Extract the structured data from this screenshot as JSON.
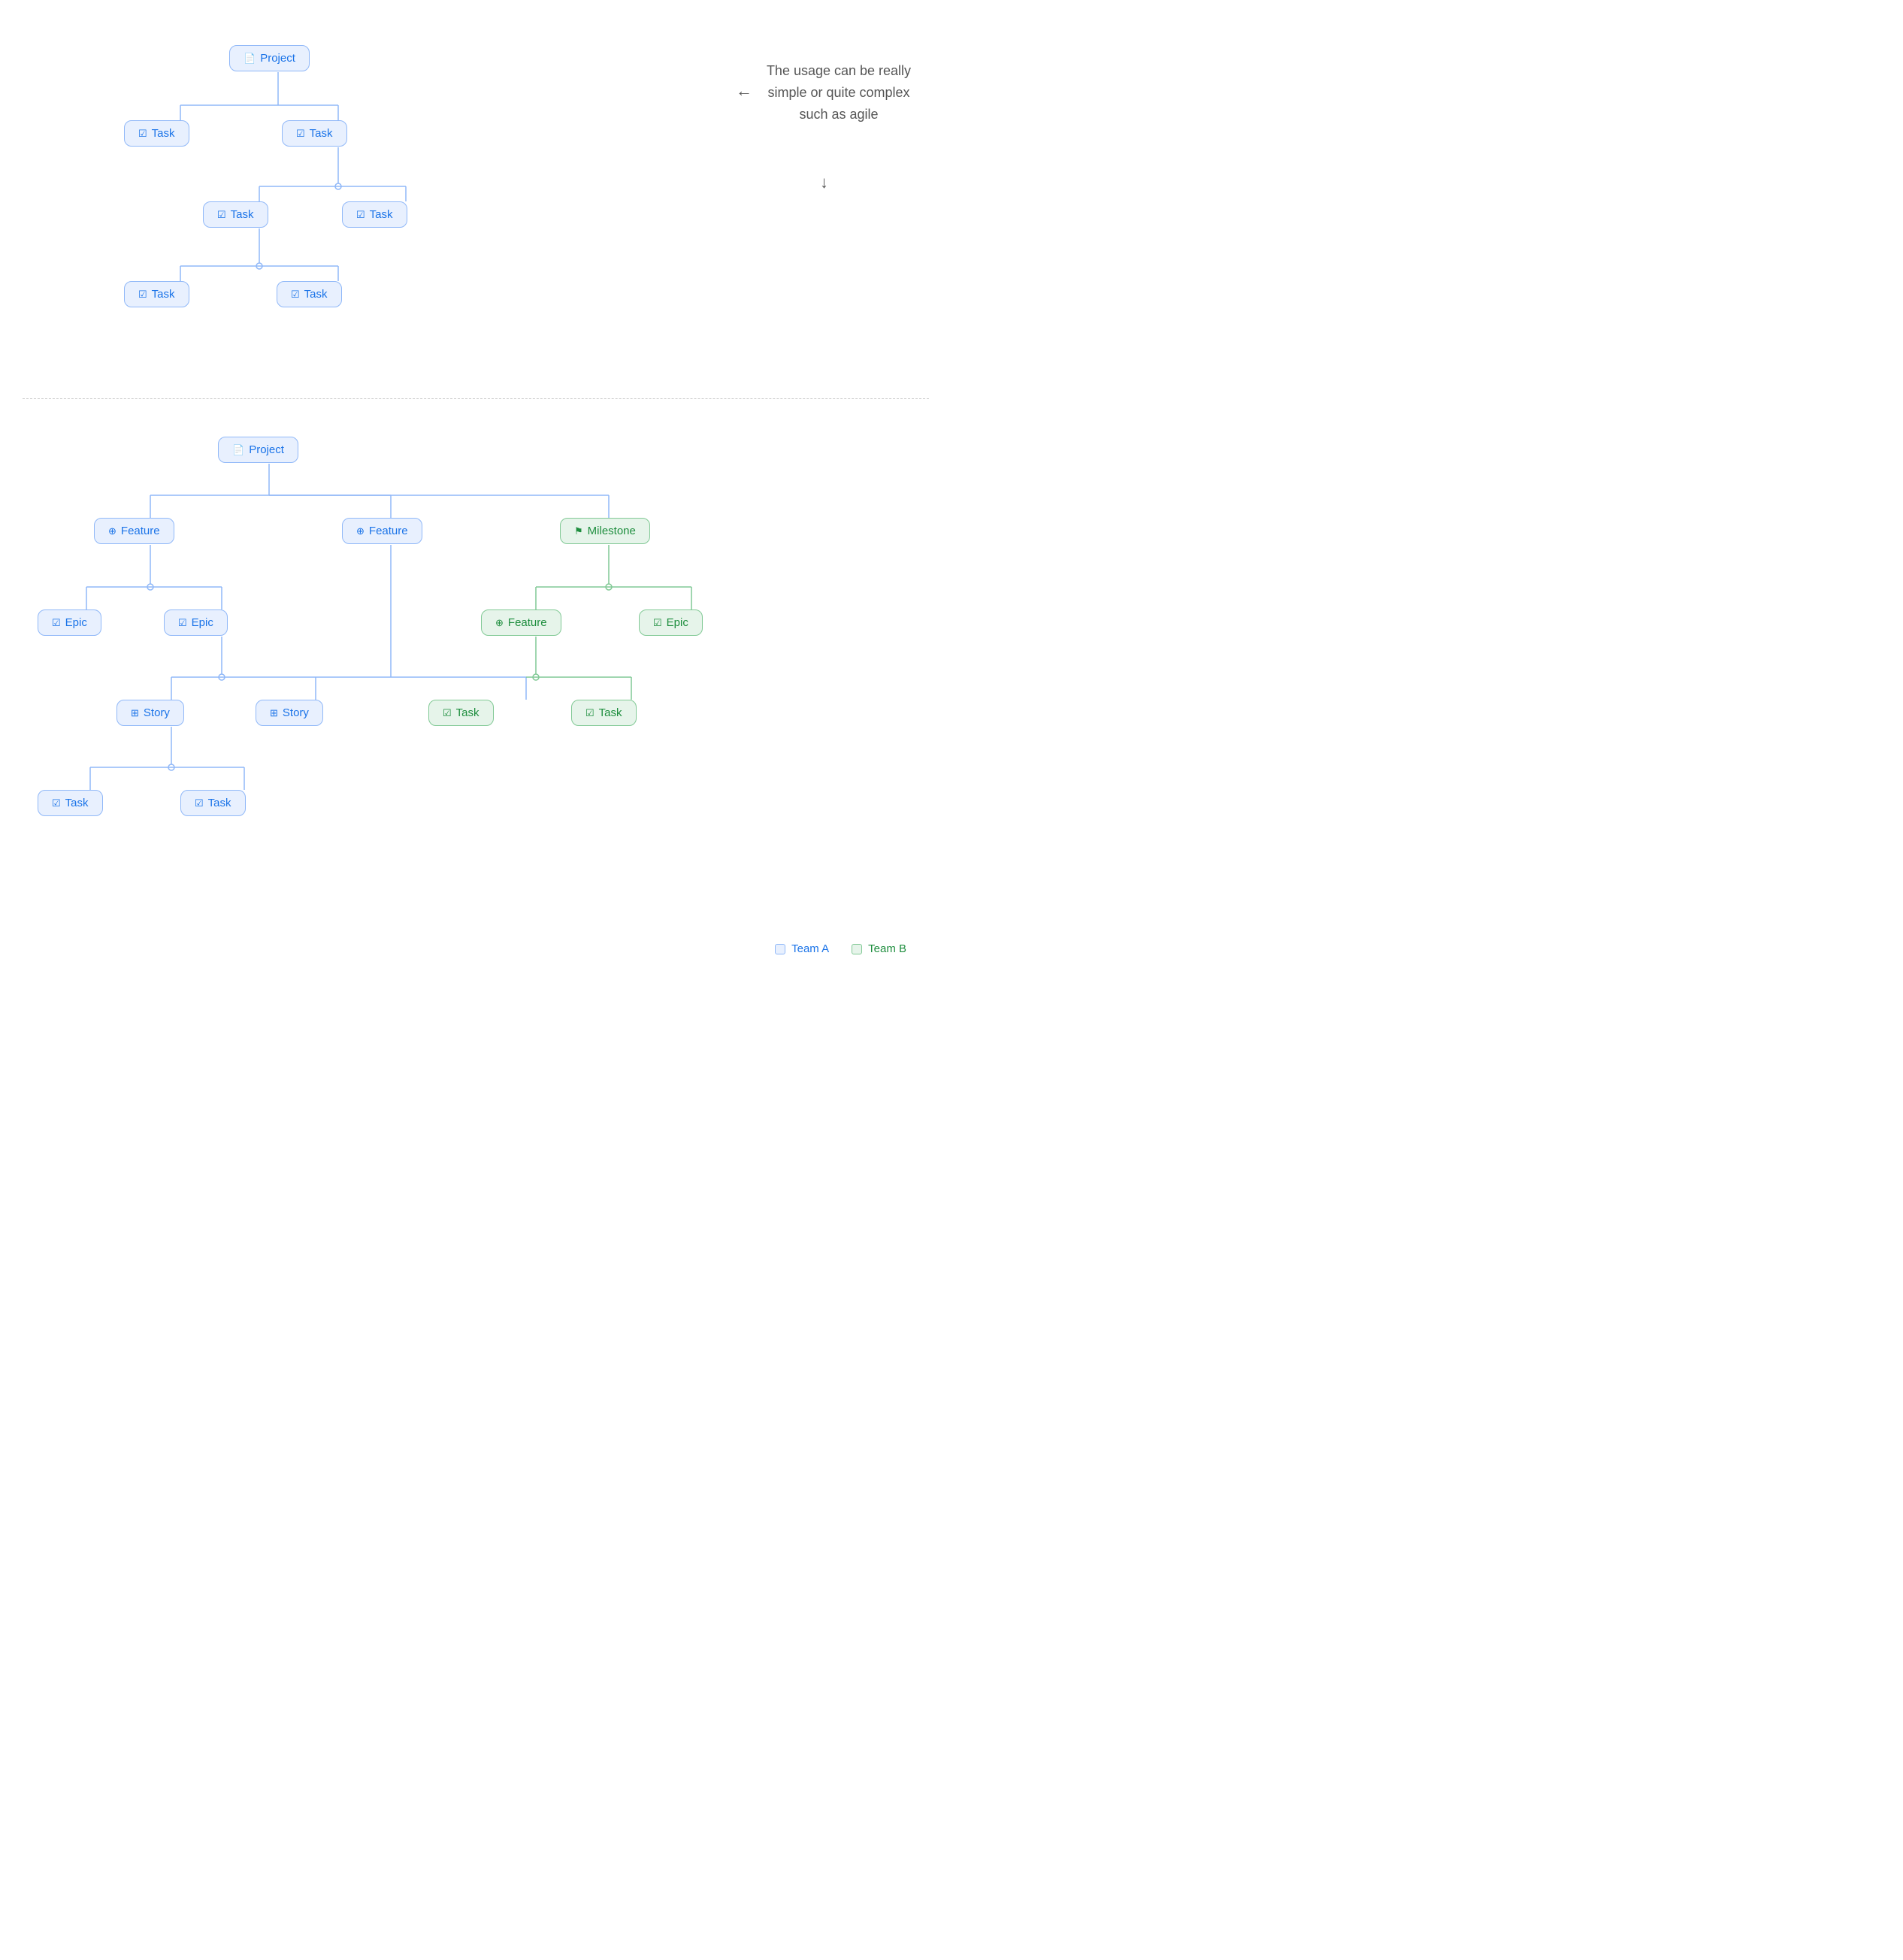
{
  "section1": {
    "nodes": {
      "project": {
        "label": "Project",
        "icon": "📄",
        "type": "blue"
      },
      "task1": {
        "label": "Task",
        "icon": "☑",
        "type": "blue"
      },
      "task2": {
        "label": "Task",
        "icon": "☑",
        "type": "blue"
      },
      "task3": {
        "label": "Task",
        "icon": "☑",
        "type": "blue"
      },
      "task4": {
        "label": "Task",
        "icon": "☑",
        "type": "blue"
      },
      "task5": {
        "label": "Task",
        "icon": "☑",
        "type": "blue"
      },
      "task6": {
        "label": "Task",
        "icon": "☑",
        "type": "blue"
      }
    },
    "annotation": {
      "text": "The usage can be really simple or quite complex such as agile",
      "arrow_left": "←",
      "arrow_down": "↓"
    }
  },
  "section2": {
    "nodes": {
      "project": {
        "label": "Project",
        "icon": "📄",
        "type": "blue"
      },
      "feature1": {
        "label": "Feature",
        "icon": "⊕",
        "type": "blue"
      },
      "feature2": {
        "label": "Feature",
        "icon": "⊕",
        "type": "blue"
      },
      "milestone": {
        "label": "Milestone",
        "icon": "⚑",
        "type": "green"
      },
      "epic1": {
        "label": "Epic",
        "icon": "☑",
        "type": "blue"
      },
      "epic2": {
        "label": "Epic",
        "icon": "☑",
        "type": "blue"
      },
      "feature3": {
        "label": "Feature",
        "icon": "⊕",
        "type": "green"
      },
      "epic3": {
        "label": "Epic",
        "icon": "☑",
        "type": "green"
      },
      "story1": {
        "label": "Story",
        "icon": "🗘",
        "type": "blue"
      },
      "story2": {
        "label": "Story",
        "icon": "🗘",
        "type": "blue"
      },
      "task_g1": {
        "label": "Task",
        "icon": "☑",
        "type": "green"
      },
      "task_g2": {
        "label": "Task",
        "icon": "☑",
        "type": "green"
      },
      "task1": {
        "label": "Task",
        "icon": "☑",
        "type": "blue"
      },
      "task2": {
        "label": "Task",
        "icon": "☑",
        "type": "blue"
      }
    },
    "legend": {
      "team_a": "Team A",
      "team_b": "Team B"
    }
  }
}
